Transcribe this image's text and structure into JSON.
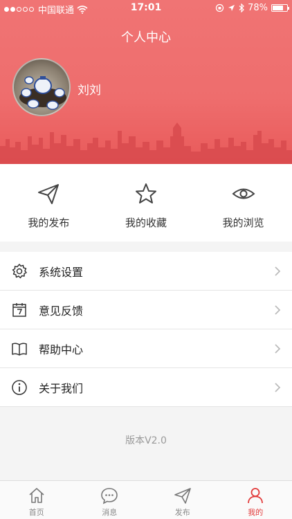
{
  "status_bar": {
    "carrier": "中国联通",
    "time": "17:01",
    "battery": "78%",
    "battery_level": 0.78
  },
  "header": {
    "title": "个人中心",
    "username": "刘刘"
  },
  "actions": [
    {
      "label": "我的发布",
      "icon": "paper-plane-icon"
    },
    {
      "label": "我的收藏",
      "icon": "star-icon"
    },
    {
      "label": "我的浏览",
      "icon": "eye-icon"
    }
  ],
  "menu": [
    {
      "label": "系统设置",
      "icon": "gear-icon"
    },
    {
      "label": "意见反馈",
      "icon": "calendar-icon"
    },
    {
      "label": "帮助中心",
      "icon": "book-icon"
    },
    {
      "label": "关于我们",
      "icon": "info-icon"
    }
  ],
  "version": "版本V2.0",
  "tabs": [
    {
      "label": "首页",
      "icon": "home-icon",
      "active": false
    },
    {
      "label": "消息",
      "icon": "chat-icon",
      "active": false
    },
    {
      "label": "发布",
      "icon": "paper-plane-icon",
      "active": false
    },
    {
      "label": "我的",
      "icon": "person-icon",
      "active": true
    }
  ],
  "colors": {
    "header_red": "#ee6d6d",
    "active_tab": "#e23b3b"
  }
}
